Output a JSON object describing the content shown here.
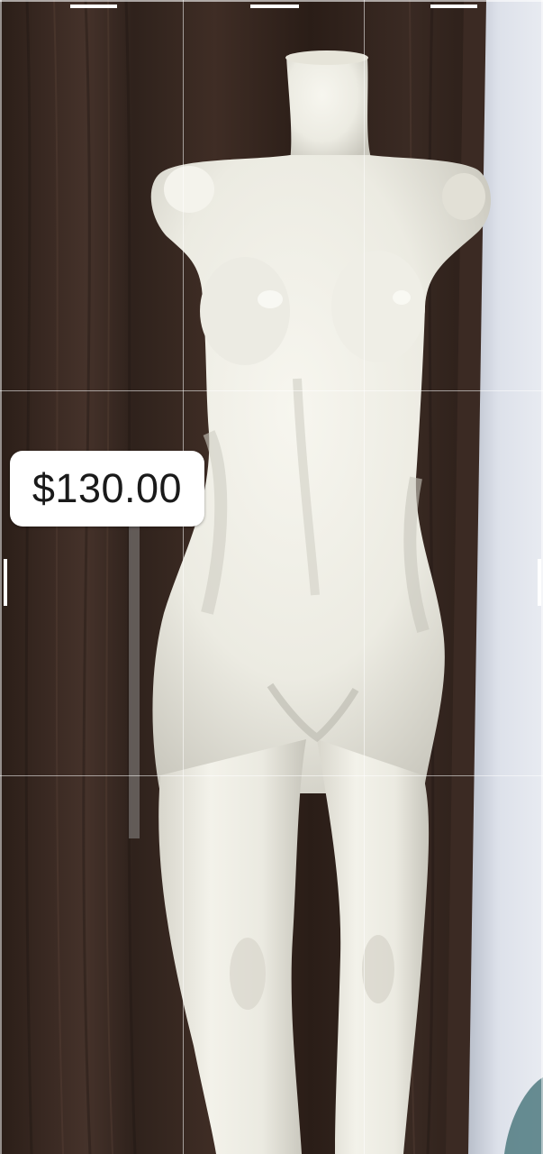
{
  "listing": {
    "price": "$130.00"
  },
  "photo": {
    "subject": "mannequin-image",
    "colors": {
      "wood_dark": "#2e201a",
      "wood_mid": "#4a352b",
      "wall": "#d9dde6",
      "mannequin": "#efeee6",
      "badge_bg": "#ffffff"
    }
  },
  "crop_overlay": {
    "grid": "rule-of-thirds",
    "handles": true
  }
}
